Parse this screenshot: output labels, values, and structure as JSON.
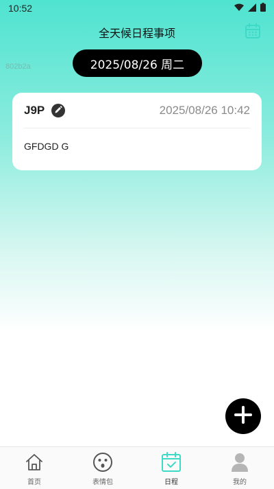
{
  "status_bar": {
    "time": "10:52"
  },
  "header": {
    "title": "全天候日程事项",
    "calendar_icon": "calendar-icon"
  },
  "debug_text": "802b2a",
  "date_selector": {
    "label": "2025/08/26 周二"
  },
  "schedule_items": [
    {
      "name": "J9P",
      "datetime": "2025/08/26 10:42",
      "content": "GFDGD G"
    }
  ],
  "fab": {
    "icon": "plus-icon"
  },
  "tabbar": {
    "items": [
      {
        "label": "首页",
        "icon": "home-icon"
      },
      {
        "label": "表情包",
        "icon": "emoji-icon"
      },
      {
        "label": "日程",
        "icon": "calendar-check-icon",
        "active": true
      },
      {
        "label": "我的",
        "icon": "user-icon"
      }
    ]
  },
  "colors": {
    "accent": "#3fd9c7",
    "gradient_top": "#4fe3d0",
    "fab": "#000000",
    "date_pill": "#000000"
  }
}
